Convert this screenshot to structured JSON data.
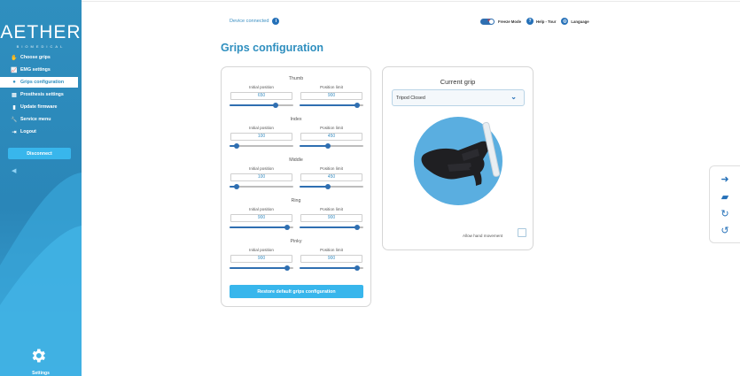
{
  "app": {
    "logo": "AETHER",
    "logo_sub": "BIOMEDICAL"
  },
  "sidebar": {
    "items": [
      {
        "label": "Choose grips",
        "icon": "hand-icon",
        "active": false
      },
      {
        "label": "EMG settings",
        "icon": "chart-icon",
        "active": false
      },
      {
        "label": "Grips configuration",
        "icon": "grip-icon",
        "active": true
      },
      {
        "label": "Prosthesis settings",
        "icon": "document-icon",
        "active": false
      },
      {
        "label": "Update firmware",
        "icon": "chip-icon",
        "active": false
      },
      {
        "label": "Service menu",
        "icon": "wrench-icon",
        "active": false
      },
      {
        "label": "Logout",
        "icon": "logout-icon",
        "active": false
      }
    ],
    "disconnect_label": "Disconnect",
    "settings_label": "Settings"
  },
  "topbar": {
    "device_status": "Device connected",
    "freeze_mode": "Freeze Mode",
    "help_tour": "Help - Tour",
    "language": "Language"
  },
  "page": {
    "title": "Grips configuration"
  },
  "grips": {
    "initial_label": "Initial position",
    "limit_label": "Position limit",
    "fingers": [
      {
        "name": "Thumb",
        "initial": "650",
        "limit": "900",
        "initial_pct": 0.72,
        "limit_pct": 0.9
      },
      {
        "name": "Index",
        "initial": "100",
        "limit": "450",
        "initial_pct": 0.11,
        "limit_pct": 0.45
      },
      {
        "name": "Middle",
        "initial": "100",
        "limit": "450",
        "initial_pct": 0.11,
        "limit_pct": 0.45
      },
      {
        "name": "Ring",
        "initial": "900",
        "limit": "900",
        "initial_pct": 0.9,
        "limit_pct": 0.9
      },
      {
        "name": "Pinky",
        "initial": "900",
        "limit": "900",
        "initial_pct": 0.9,
        "limit_pct": 0.9
      }
    ],
    "restore_label": "Restore default grips configuration"
  },
  "current_grip": {
    "title": "Current grip",
    "selected": "Tripod Closed",
    "allow_movement_label": "Allow hand movement",
    "allow_movement_checked": false
  },
  "colors": {
    "primary": "#2f8fbf",
    "accent": "#38b6ec",
    "dark_blue": "#2470b8"
  }
}
